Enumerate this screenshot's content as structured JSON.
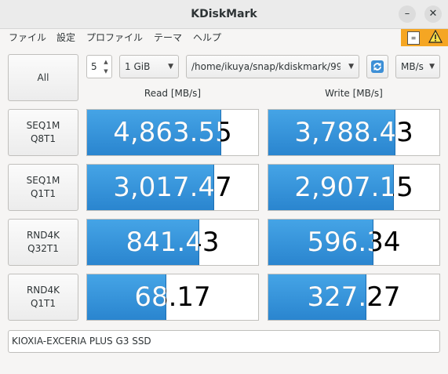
{
  "window": {
    "title": "KDiskMark",
    "minimize_glyph": "–",
    "close_glyph": "✕"
  },
  "menu": [
    "ファイル",
    "設定",
    "プロファイル",
    "テーマ",
    "ヘルプ"
  ],
  "toolbar": {
    "all_label": "All",
    "loops": "5",
    "size": "1 GiB",
    "path": "/home/ikuya/snap/kdiskmark/99",
    "unit": "MB/s"
  },
  "headers": {
    "read": "Read [MB/s]",
    "write": "Write [MB/s]"
  },
  "tests": [
    {
      "line1": "SEQ1M",
      "line2": "Q8T1",
      "read": "4,863.55",
      "read_level": 0.78,
      "write": "3,788.43",
      "write_level": 0.74
    },
    {
      "line1": "SEQ1M",
      "line2": "Q1T1",
      "read": "3,017.47",
      "read_level": 0.74,
      "write": "2,907.15",
      "write_level": 0.73
    },
    {
      "line1": "RND4K",
      "line2": "Q32T1",
      "read": "841.43",
      "read_level": 0.65,
      "write": "596.34",
      "write_level": 0.61
    },
    {
      "line1": "RND4K",
      "line2": "Q1T1",
      "read": "68.17",
      "read_level": 0.46,
      "write": "327.27",
      "write_level": 0.57
    }
  ],
  "device": "KIOXIA-EXCERIA PLUS G3 SSD",
  "icons": {
    "refresh": "refresh-icon",
    "warning": "warning-icon",
    "clipboard": "clipboard-icon"
  },
  "colors": {
    "bar_top": "#45a4e6",
    "bar_bottom": "#2a85cf",
    "warning_bg": "#f5a623"
  }
}
